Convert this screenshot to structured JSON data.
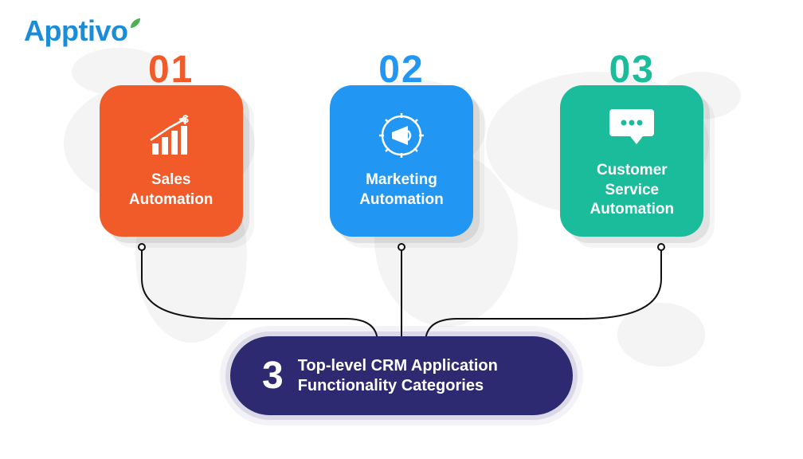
{
  "brand": {
    "name": "Apptivo"
  },
  "hub": {
    "count": "3",
    "line1": "Top-level CRM Application",
    "line2": "Functionality Categories"
  },
  "cards": [
    {
      "num": "01",
      "label": "Sales Automation",
      "color": "#f15a29",
      "icon": "growth-chart"
    },
    {
      "num": "02",
      "label": "Marketing Automation",
      "color": "#2196f3",
      "icon": "megaphone-gear"
    },
    {
      "num": "03",
      "label": "Customer Service Automation",
      "color": "#1abc9c",
      "icon": "chat-bubble"
    }
  ]
}
